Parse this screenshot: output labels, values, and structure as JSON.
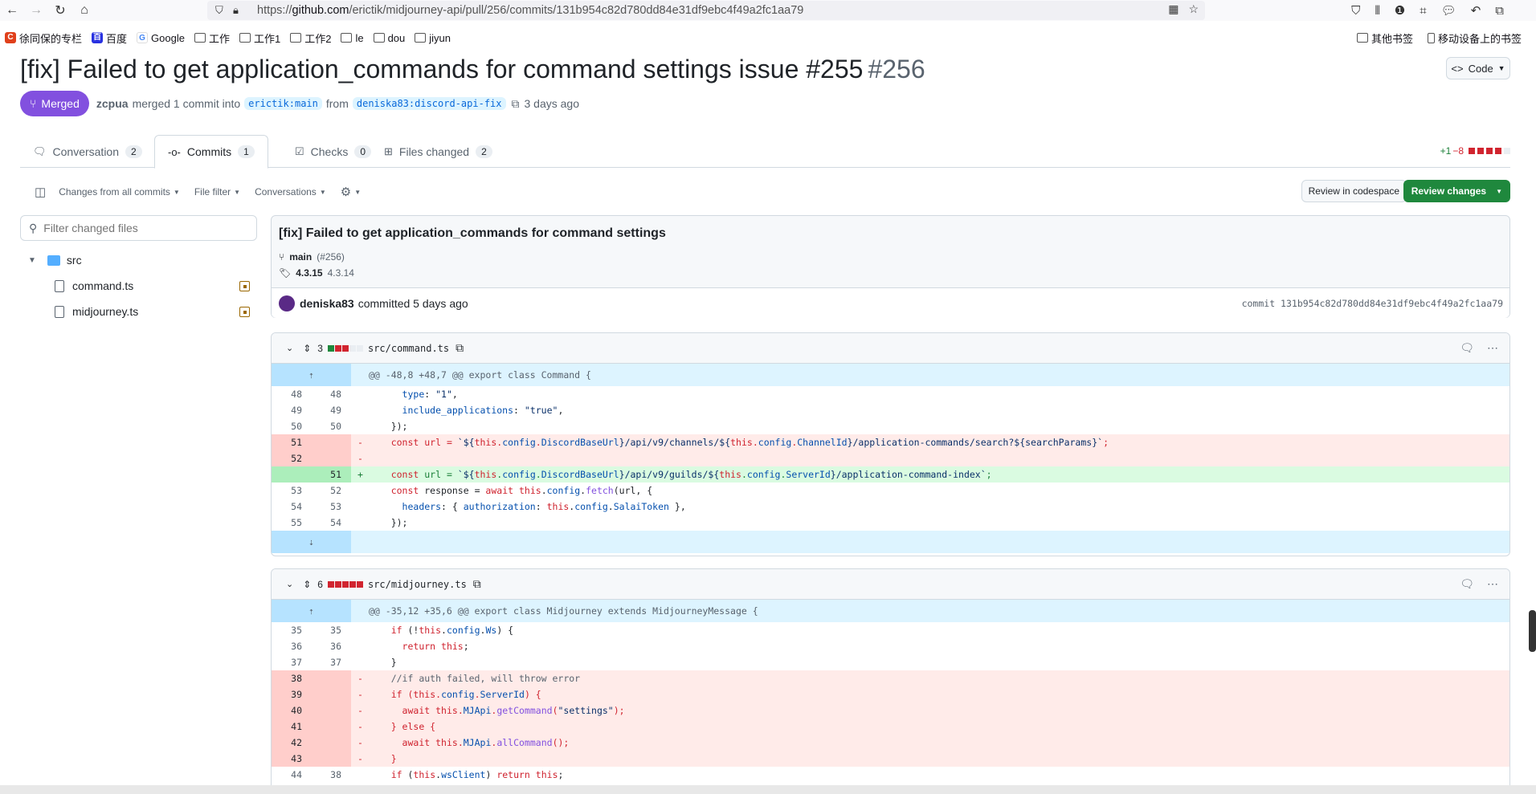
{
  "browser": {
    "url_prefix": "https://",
    "url_host": "github.com",
    "url_path": "/erictik/midjourney-api/pull/256/commits/131b954c82d780dd84e31df9ebc4f49a2fc1aa79"
  },
  "bookmarks": {
    "left": [
      "徐同保的专栏",
      "百度",
      "Google",
      "工作",
      "工作1",
      "工作2",
      "le",
      "dou",
      "jiyun"
    ],
    "right": [
      "其他书签",
      "移动设备上的书签"
    ]
  },
  "pr": {
    "title": "[fix] Failed to get application_commands for command settings issue #255",
    "number": "#256",
    "code_button": "Code",
    "status": "Merged",
    "author": "zcpua",
    "merged_text": "merged 1 commit into",
    "base_branch": "erictik:main",
    "from_text": "from",
    "head_branch": "deniska83:discord-api-fix",
    "time": "3 days ago"
  },
  "tabs": [
    {
      "label": "Conversation",
      "count": "2"
    },
    {
      "label": "Commits",
      "count": "1"
    },
    {
      "label": "Checks",
      "count": "0"
    },
    {
      "label": "Files changed",
      "count": "2"
    }
  ],
  "diffstat": {
    "additions": "+1",
    "deletions": "−8"
  },
  "subbar": {
    "changes_from": "Changes from all commits",
    "file_filter": "File filter",
    "conversations": "Conversations",
    "review_codespace": "Review in codespace",
    "review_changes": "Review changes"
  },
  "filetree": {
    "filter_placeholder": "Filter changed files",
    "folder": "src",
    "files": [
      "command.ts",
      "midjourney.ts"
    ]
  },
  "commit": {
    "title": "[fix] Failed to get application_commands for command settings",
    "branch": "main",
    "pr_ref": "(#256)",
    "tag1": "4.3.15",
    "tag2": "4.3.14",
    "author": "deniska83",
    "committed": "committed 5 days ago",
    "sha_label": "commit 131b954c82d780dd84e31df9ebc4f49a2fc1aa79"
  },
  "files": [
    {
      "count": "3",
      "name": "src/command.ts",
      "hunk": "@@ -48,8 +48,7 @@ export class Command {"
    },
    {
      "count": "6",
      "name": "src/midjourney.ts",
      "hunk": "@@ -35,12 +35,6 @@ export class Midjourney extends MidjourneyMessage {"
    }
  ],
  "colors": {
    "merged": "#8250df",
    "green_button": "#1f883d",
    "link": "#0969da",
    "deleted_bg": "#ffebe9",
    "added_bg": "#dafbe1"
  }
}
